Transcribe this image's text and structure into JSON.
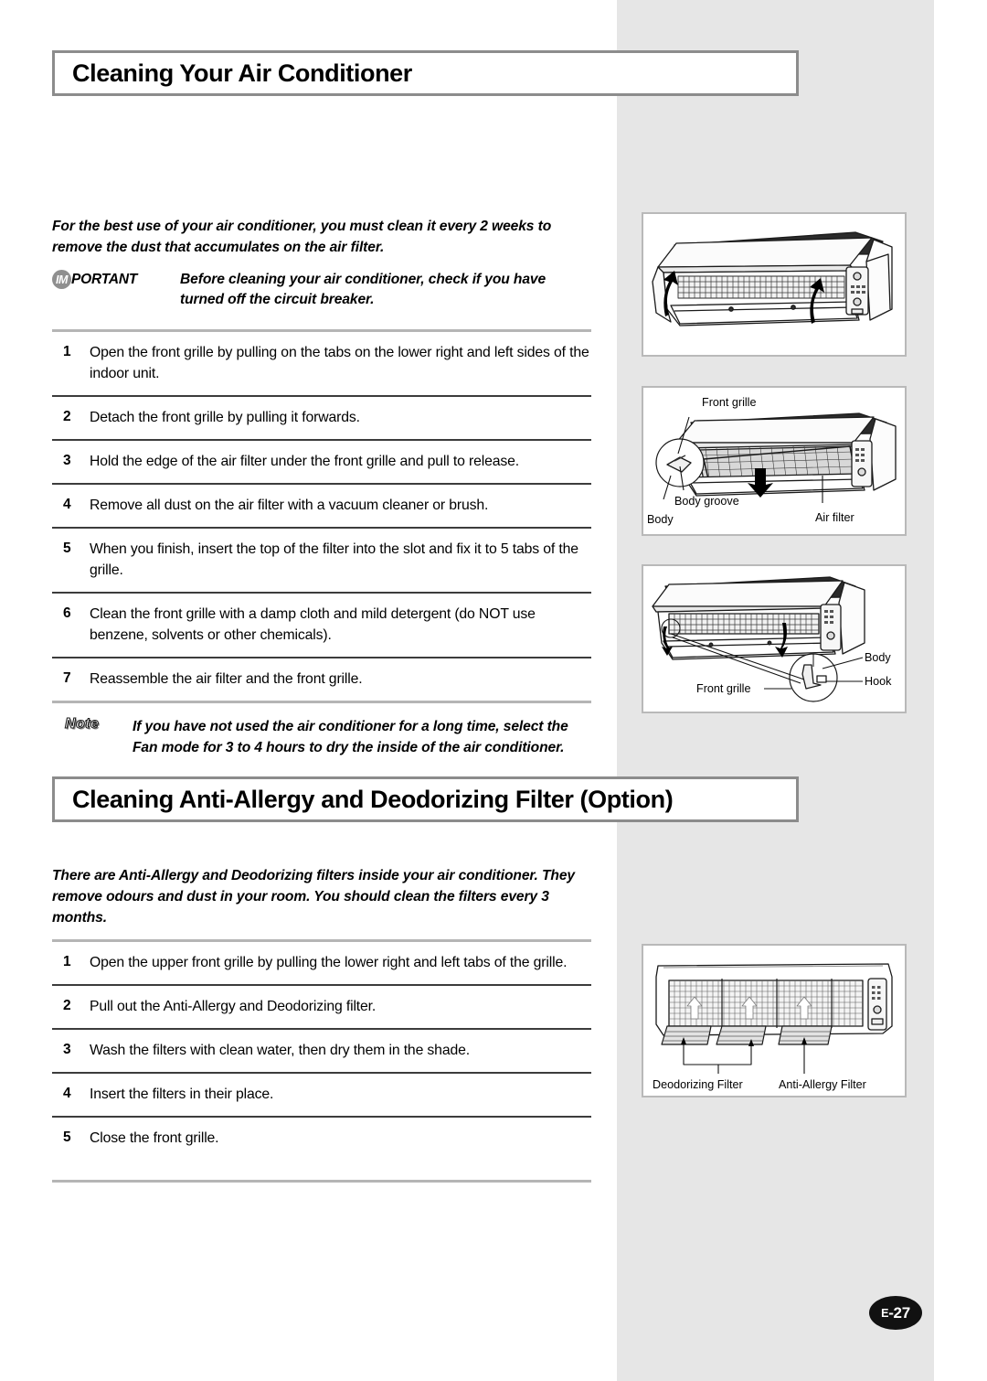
{
  "page": {
    "number_prefix": "E",
    "number": "-27",
    "number_full": "E-27"
  },
  "section1": {
    "heading": "Cleaning Your Air Conditioner",
    "intro": "For the best use of your air conditioner, you must clean it every 2 weeks to remove the dust that accumulates on the air filter.",
    "important": {
      "badge": "IM",
      "label_rest": "PORTANT",
      "text": "Before cleaning your air conditioner, check if you have turned off the circuit breaker."
    },
    "steps": [
      {
        "num": "1",
        "text": "Open the front grille by pulling on the tabs on the lower right and left sides of the indoor unit."
      },
      {
        "num": "2",
        "text": "Detach the front grille by pulling it forwards."
      },
      {
        "num": "3",
        "text": "Hold the edge of the air filter under the front grille and pull to release."
      },
      {
        "num": "4",
        "text": "Remove all dust on the air filter with a vacuum cleaner or brush."
      },
      {
        "num": "5",
        "text": "When you finish, insert the top of the filter into the slot and fix it to 5 tabs of the grille."
      },
      {
        "num": "6",
        "text": "Clean the front grille with a damp cloth and mild detergent (do NOT use benzene, solvents or other chemicals)."
      },
      {
        "num": "7",
        "text": "Reassemble the air filter and the front grille."
      }
    ],
    "note": {
      "label": "Note",
      "text": "If you have not used the air conditioner for a long time, select the Fan mode for 3 to 4 hours to dry the inside of the air conditioner."
    }
  },
  "section2": {
    "heading": "Cleaning Anti-Allergy and Deodorizing Filter (Option)",
    "intro": "There are Anti-Allergy and Deodorizing filters inside your air conditioner. They remove odours and dust in your room. You should clean the filters every 3 months.",
    "steps": [
      {
        "num": "1",
        "text": "Open the upper front grille by pulling the lower right and left tabs of the grille."
      },
      {
        "num": "2",
        "text": "Pull out the Anti-Allergy and Deodorizing filter."
      },
      {
        "num": "3",
        "text": "Wash the filters with clean water, then dry them in the shade."
      },
      {
        "num": "4",
        "text": "Insert the filters in their place."
      },
      {
        "num": "5",
        "text": "Close the front grille."
      }
    ]
  },
  "illustrations": {
    "panel1": {
      "caption": "indoor unit with front grille opening upward",
      "labels": []
    },
    "panel2": {
      "caption": "front grille detached showing air filter",
      "labels": [
        "Front grille",
        "Body groove",
        "Body",
        "Air filter"
      ]
    },
    "panel3": {
      "caption": "front grille hook detail",
      "labels": [
        "Body",
        "Hook",
        "Front grille"
      ]
    },
    "panel4": {
      "caption": "deodorizing and anti-allergy filters being removed",
      "labels": [
        "Deodorizing Filter",
        "Anti-Allergy Filter"
      ]
    }
  }
}
